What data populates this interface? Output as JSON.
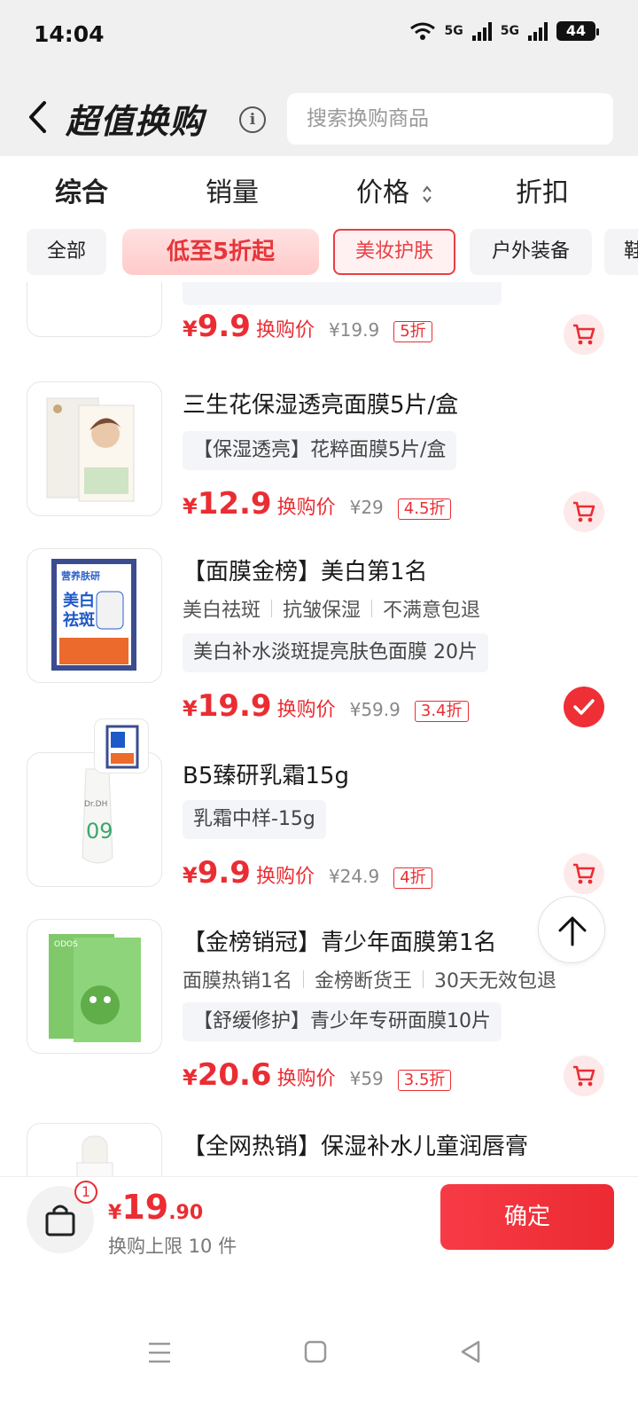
{
  "status": {
    "time": "14:04",
    "net1": "5G",
    "net2": "5G",
    "battery": "44"
  },
  "header": {
    "title": "超值换购",
    "info_icon": "info-icon",
    "search_placeholder": "搜索换购商品"
  },
  "sort_tabs": [
    {
      "label": "综合",
      "active": true
    },
    {
      "label": "销量",
      "active": false
    },
    {
      "label": "价格",
      "active": false
    },
    {
      "label": "折扣",
      "active": false
    }
  ],
  "categories": [
    {
      "label": "全部"
    },
    {
      "label": "低至5折起"
    },
    {
      "label": "美妆护肤"
    },
    {
      "label": "户外装备"
    },
    {
      "label": "鞋"
    }
  ],
  "products": [
    {
      "price_cur": "¥",
      "price": "9.9",
      "price_label": "换购价",
      "original": "¥19.9",
      "discount": "5折",
      "action": "cart"
    },
    {
      "name": "三生花保湿透亮面膜5片/盒",
      "spec": "【保湿透亮】花粹面膜5片/盒",
      "price_cur": "¥",
      "price": "12.9",
      "price_label": "换购价",
      "original": "¥29",
      "discount": "4.5折",
      "action": "cart"
    },
    {
      "name": "【面膜金榜】美白第1名",
      "tags": [
        "美白祛斑",
        "抗皱保湿",
        "不满意包退"
      ],
      "spec": "美白补水淡斑提亮肤色面膜 20片",
      "price_cur": "¥",
      "price": "19.9",
      "price_label": "换购价",
      "original": "¥59.9",
      "discount": "3.4折",
      "action": "selected"
    },
    {
      "name": "B5臻研乳霜15g",
      "spec": "乳霜中样-15g",
      "price_cur": "¥",
      "price": "9.9",
      "price_label": "换购价",
      "original": "¥24.9",
      "discount": "4折",
      "action": "cart"
    },
    {
      "name": "【金榜销冠】青少年面膜第1名",
      "tags": [
        "面膜热销1名",
        "金榜断货王",
        "30天无效包退"
      ],
      "spec": "【舒缓修护】青少年专研面膜10片",
      "price_cur": "¥",
      "price": "20.6",
      "price_label": "换购价",
      "original": "¥59",
      "discount": "3.5折",
      "action": "cart"
    },
    {
      "name": "【全网热销】保湿补水儿童润唇膏"
    }
  ],
  "bottom": {
    "badge": "1",
    "total_cur": "¥",
    "total_int": "19",
    "total_dec": ".90",
    "limit": "换购上限 10 件",
    "confirm": "确定"
  },
  "colors": {
    "accent": "#ea2d33",
    "header_bg": "#f0f0f0",
    "chip_bg": "#f4f4f6"
  }
}
